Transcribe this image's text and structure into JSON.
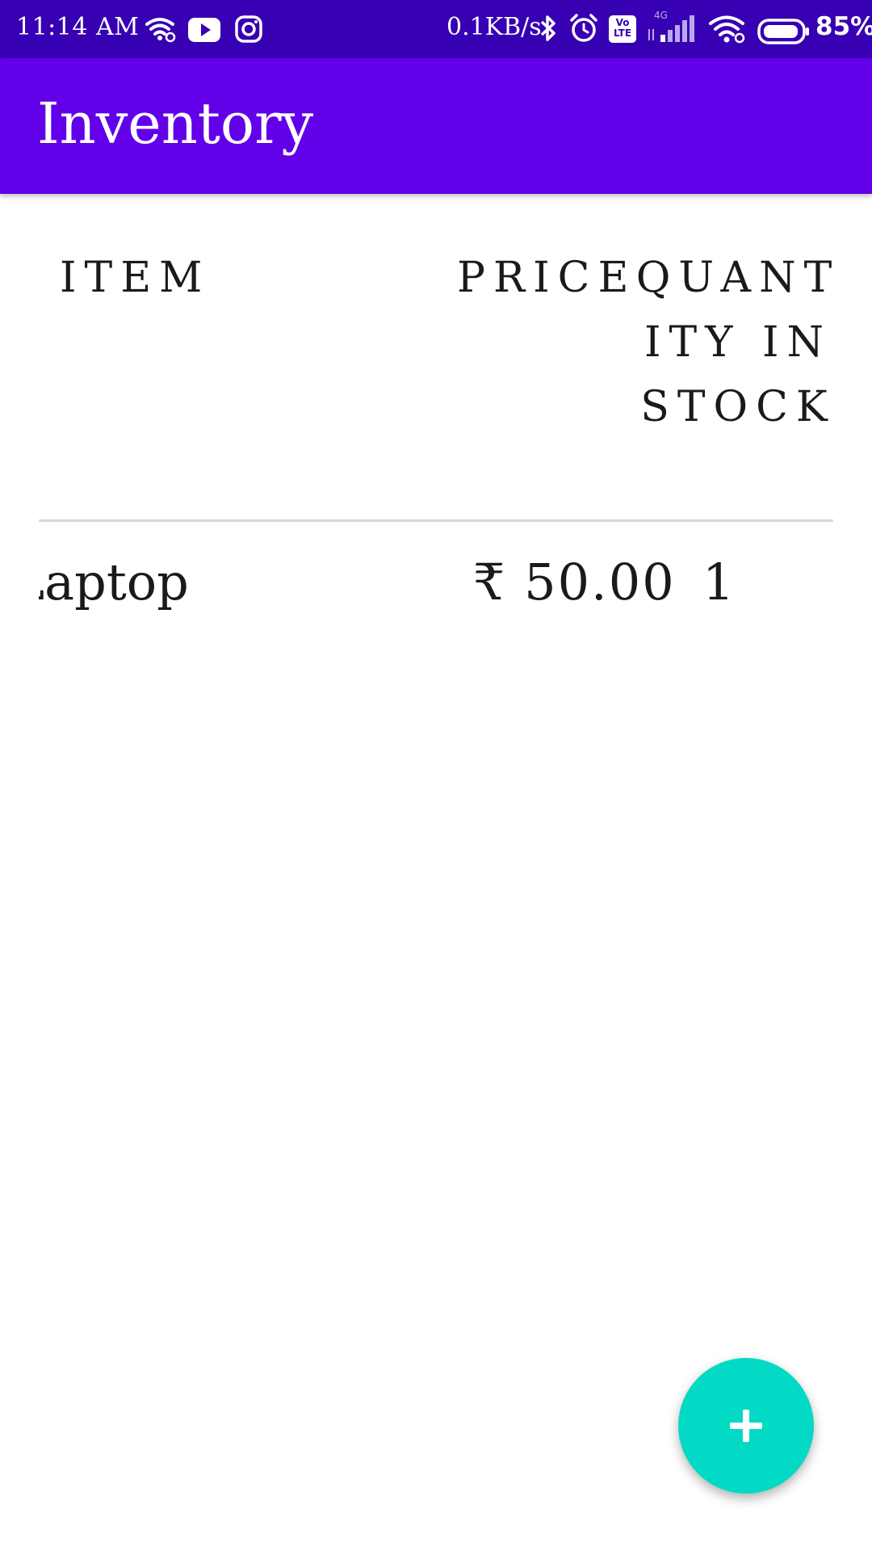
{
  "status_bar": {
    "time": "11:14 AM",
    "net_speed": "0.1KB/s",
    "battery_percent": "85%",
    "icons": [
      "wifi-icon",
      "youtube-icon",
      "instagram-icon",
      "bluetooth-icon",
      "alarm-icon",
      "volte-icon",
      "signal-4g-icon",
      "wifi-icon",
      "battery-icon"
    ],
    "network_label": "4G",
    "volte_label": "Vo LTE",
    "battery_level": 0.85
  },
  "app_bar": {
    "title": "Inventory"
  },
  "table": {
    "headers": {
      "item": "ITEM",
      "price": "PRICE",
      "quantity": "QUANTITY IN STOCK"
    },
    "rows": [
      {
        "item": "Laptop",
        "price": "₹ 50.00",
        "quantity": "1"
      }
    ]
  },
  "fab": {
    "icon": "add-icon"
  },
  "colors": {
    "status_bar": "#3700b3",
    "app_bar": "#6200ea",
    "fab": "#03dac5",
    "divider": "#d9d9d9",
    "text": "#1a1a1a"
  }
}
